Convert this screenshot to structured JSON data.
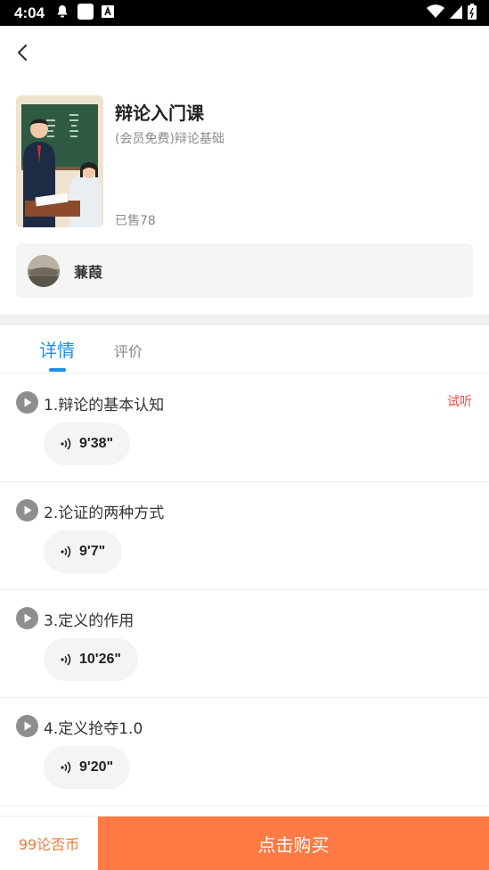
{
  "status_bar": {
    "time": "4:04"
  },
  "course": {
    "title": "辩论入门课",
    "subtitle": "(会员免费)辩论基础",
    "sold": "已售78"
  },
  "teacher": {
    "name": "蒹葭"
  },
  "tabs": [
    {
      "label": "详情",
      "active": true
    },
    {
      "label": "评价",
      "active": false
    }
  ],
  "lessons": [
    {
      "title": "1.辩论的基本认知",
      "duration": "9'38\"",
      "tag": "试听"
    },
    {
      "title": "2.论证的两种方式",
      "duration": "9'7\"",
      "tag": ""
    },
    {
      "title": "3.定义的作用",
      "duration": "10'26\"",
      "tag": ""
    },
    {
      "title": "4.定义抢夺1.0",
      "duration": "9'20\"",
      "tag": ""
    }
  ],
  "footer": {
    "price": "99论否币",
    "buy_label": "点击购买"
  },
  "colors": {
    "accent": "#1e8fe8",
    "buy_button": "#ff7a45",
    "price_text": "#f07a3c",
    "trial_tag": "#f04a3e"
  },
  "icons": [
    "back-icon",
    "play-icon",
    "audio-wave-icon",
    "wifi-icon",
    "signal-icon",
    "battery-icon"
  ]
}
